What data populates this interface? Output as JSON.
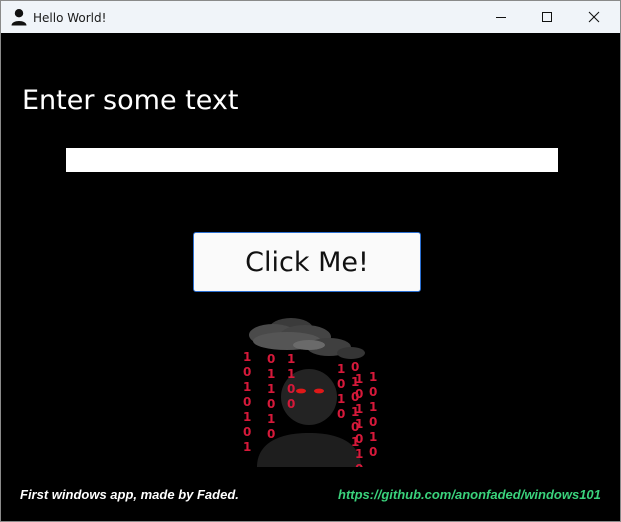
{
  "window": {
    "title": "Hello World!",
    "app_icon": "person-icon",
    "controls": [
      "minimize-icon",
      "maximize-icon",
      "close-icon"
    ]
  },
  "main": {
    "heading": "Enter some text",
    "input": {
      "value": "",
      "placeholder": ""
    },
    "button_label": "Click Me!"
  },
  "illustration": {
    "description_icon": "hacker-figure-icon",
    "binary_columns": [
      [
        "1",
        "0",
        "1",
        "0",
        "1",
        "0",
        "1"
      ],
      [
        "0",
        "1",
        "1",
        "0",
        "1",
        "0"
      ],
      [
        "1",
        "1",
        "0",
        "0"
      ],
      [
        "1",
        "0",
        "1",
        "0"
      ],
      [
        "0",
        "1",
        "0",
        "1",
        "0",
        "1"
      ],
      [
        "1",
        "0",
        "1",
        "0",
        "1",
        "0"
      ],
      [
        "1",
        "0",
        "1",
        "1",
        "0",
        "1",
        "0"
      ]
    ]
  },
  "footer": {
    "credit": "First windows app, made by Faded.",
    "link": "https://github.com/anonfaded/windows101"
  },
  "colors": {
    "background": "#000000",
    "link": "#3ad27c",
    "binary": "#d6193a",
    "button_border": "#2b6fd1"
  }
}
